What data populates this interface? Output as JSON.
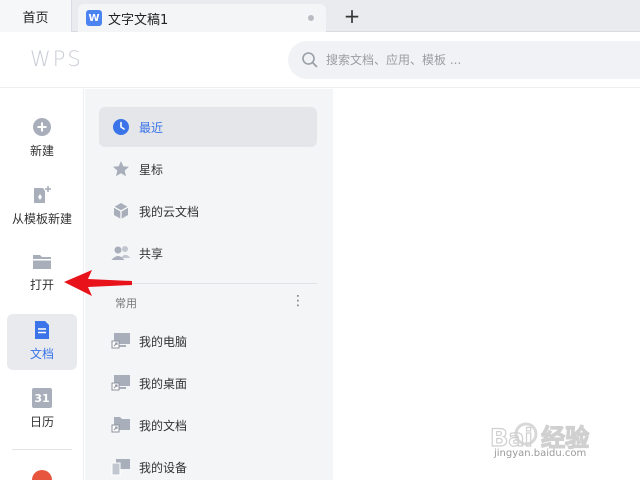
{
  "tabs": {
    "home_label": "首页",
    "doc_label": "文字文稿1",
    "doc_icon_letter": "W",
    "add_label": "+"
  },
  "header": {
    "logo_text": "WPS",
    "search_placeholder": "搜索文档、应用、模板 ..."
  },
  "rail": {
    "items": [
      {
        "label": "新建",
        "icon": "plus-circle-icon"
      },
      {
        "label": "从模板新建",
        "icon": "template-icon"
      },
      {
        "label": "打开",
        "icon": "folder-icon"
      },
      {
        "label": "文档",
        "icon": "document-icon",
        "active": true
      },
      {
        "label": "日历",
        "icon": "calendar-icon",
        "calendar_day": "31"
      }
    ]
  },
  "nav": {
    "items": [
      {
        "label": "最近",
        "icon": "clock-icon",
        "active": true
      },
      {
        "label": "星标",
        "icon": "star-icon"
      },
      {
        "label": "我的云文档",
        "icon": "cloud-box-icon"
      },
      {
        "label": "共享",
        "icon": "people-icon"
      }
    ],
    "section_title": "常用",
    "more_label": "⋮",
    "common": [
      {
        "label": "我的电脑",
        "icon": "computer-shortcut-icon"
      },
      {
        "label": "我的桌面",
        "icon": "desktop-shortcut-icon"
      },
      {
        "label": "我的文档",
        "icon": "folder-shortcut-icon"
      },
      {
        "label": "我的设备",
        "icon": "device-icon"
      }
    ]
  },
  "watermark": {
    "text": "jingyan.baidu.com",
    "logo_text": "Bai 经验"
  },
  "colors": {
    "accent": "#3a74e8",
    "arrow": "#e8121a"
  }
}
